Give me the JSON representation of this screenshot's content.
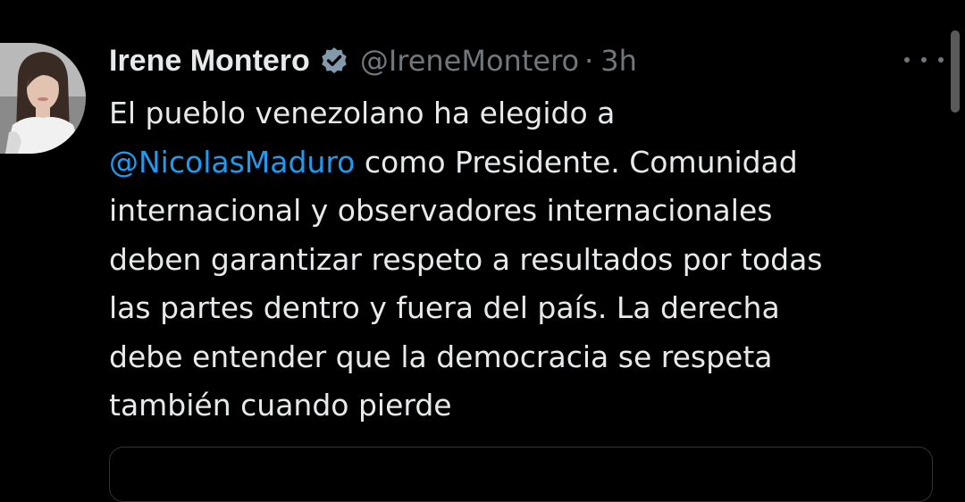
{
  "tweet": {
    "author": {
      "display_name": "Irene Montero",
      "handle": "@IreneMontero",
      "verified": true,
      "verified_icon": "verified-badge-icon"
    },
    "separator": "·",
    "time": "3h",
    "more_icon": "more-options-icon",
    "body": {
      "line1": "El pueblo venezolano ha elegido a",
      "mention": "@NicolasMaduro",
      "line2_rest": " como Presidente. Comunidad",
      "line3": "internacional y observadores internacionales",
      "line4": "deben garantizar respeto a resultados por todas",
      "line5": "las partes dentro y fuera del país. La derecha",
      "line6": "debe entender que la democracia se respeta",
      "line7": "también cuando pierde"
    }
  },
  "colors": {
    "background": "#000000",
    "text": "#e7e9ea",
    "secondary": "#71767b",
    "mention": "#1d9bf0",
    "verified_badge": "#829aab"
  }
}
